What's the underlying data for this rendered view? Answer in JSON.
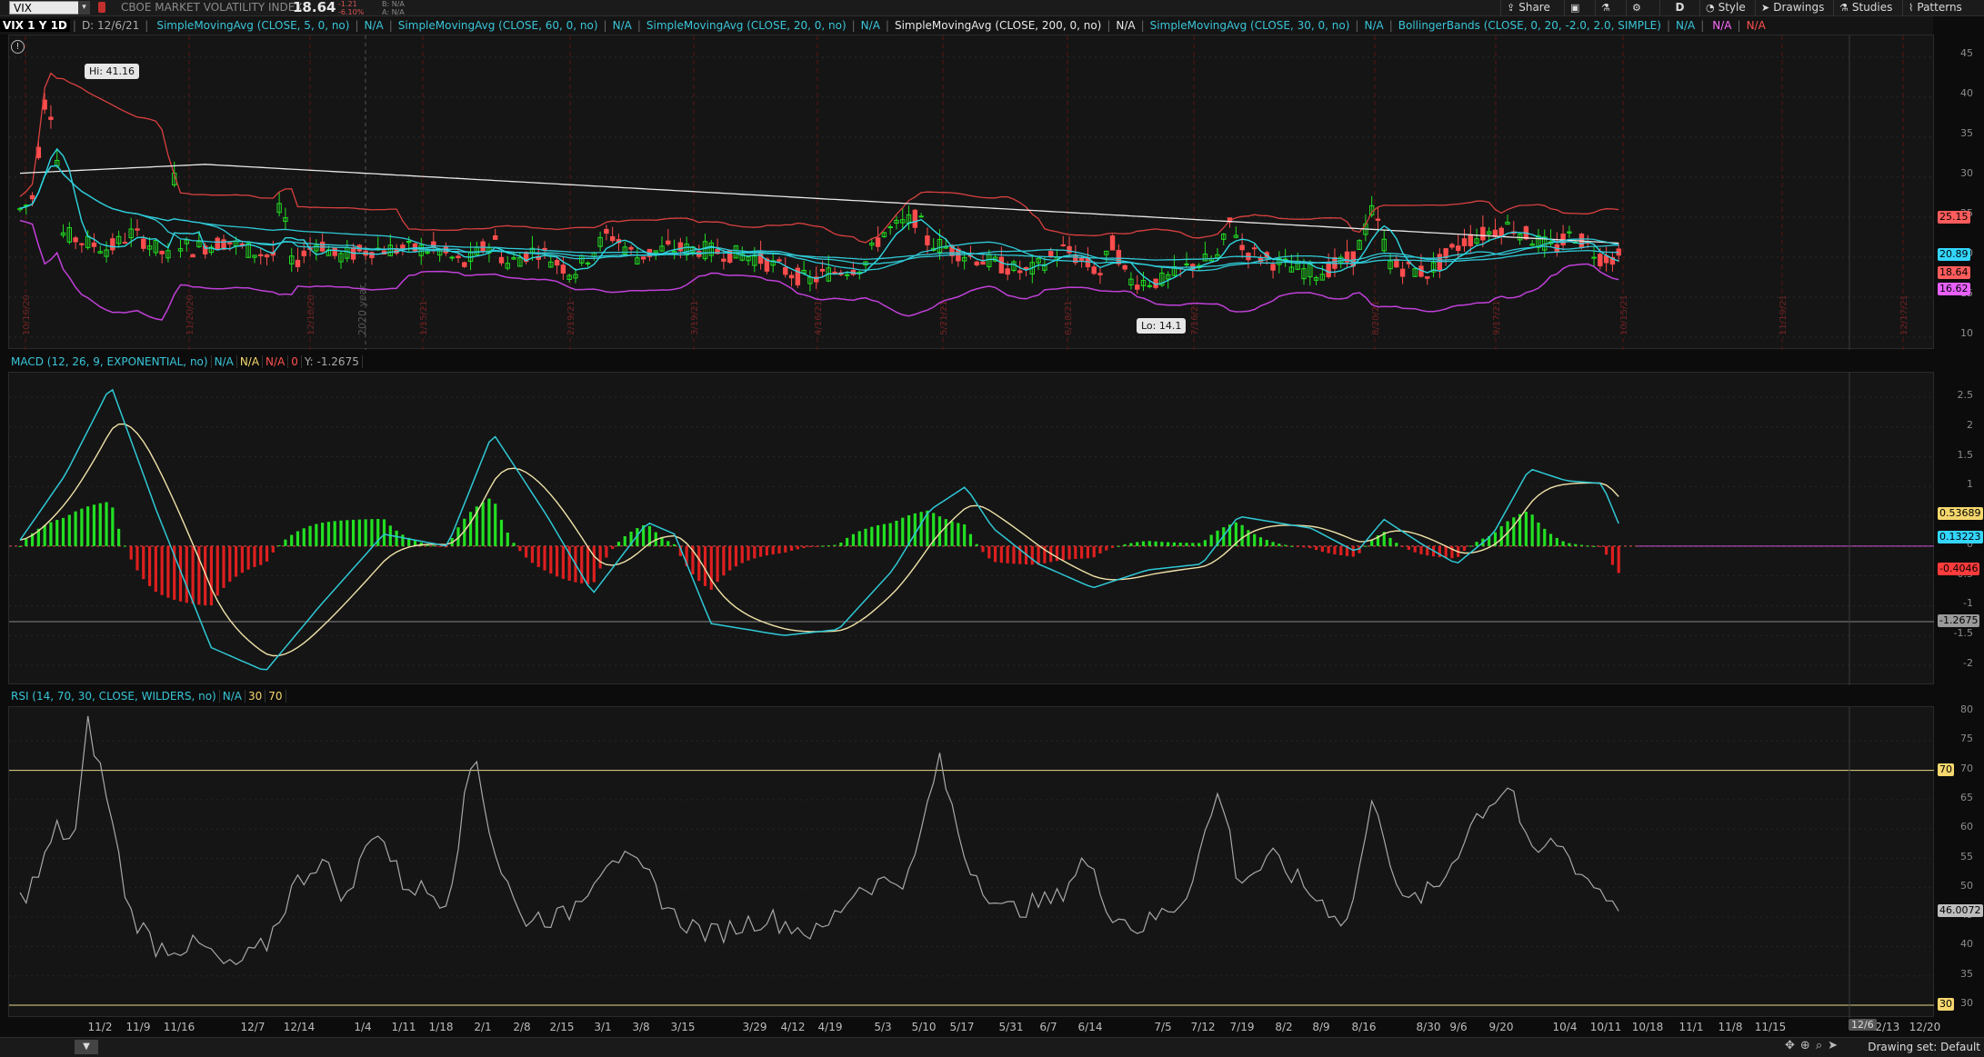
{
  "toolbar": {
    "symbol": "VIX",
    "description": "CBOE MARKET VOLATILITY INDEX",
    "last": "18.64",
    "net_change": "-1.21",
    "pct_change": "-6.10%",
    "bid": "B: N/A",
    "ask": "A: N/A",
    "share": "Share",
    "aggregation": "D",
    "style": "Style",
    "drawings": "Drawings",
    "studies": "Studies",
    "patterns": "Patterns"
  },
  "studybar": {
    "period": "VIX 1 Y 1D",
    "date": "D: 12/6/21",
    "items": [
      {
        "label": "SimpleMovingAvg (CLOSE, 5, 0, no)",
        "value": "N/A",
        "color": "#39c5d8"
      },
      {
        "label": "SimpleMovingAvg (CLOSE, 60, 0, no)",
        "value": "N/A",
        "color": "#39c5d8"
      },
      {
        "label": "SimpleMovingAvg (CLOSE, 20, 0, no)",
        "value": "N/A",
        "color": "#39c5d8"
      },
      {
        "label": "SimpleMovingAvg (CLOSE, 200, 0, no)",
        "value": "N/A",
        "color": "#e8e8e8"
      },
      {
        "label": "SimpleMovingAvg (CLOSE, 30, 0, no)",
        "value": "N/A",
        "color": "#39c5d8"
      },
      {
        "label": "BollingerBands (CLOSE, 0, 20, -2.0, 2.0, SIMPLE)",
        "value": "N/A",
        "color": "#39c5d8"
      }
    ],
    "extra1": "N/A",
    "extra2": "N/A"
  },
  "price_pane": {
    "hi_bubble": "Hi: 41.16",
    "lo_bubble": "Lo: 14.1",
    "watermark": "2020 year",
    "yticks": [
      "45",
      "40",
      "35",
      "30",
      "25",
      "20",
      "15",
      "10"
    ],
    "labels": [
      {
        "text": "25.15",
        "color": "#ff5c5c"
      },
      {
        "text": "20.89",
        "color": "#33d6ff"
      },
      {
        "text": "18.64",
        "color": "#ff5c5c"
      },
      {
        "text": "16.62",
        "color": "#e860ff"
      }
    ],
    "vdates": [
      "10/16/20",
      "11/20/20",
      "12/18/20",
      "1/15/21",
      "2/19/21",
      "3/19/21",
      "4/16/21",
      "5/21/21",
      "6/18/21",
      "7/16/21",
      "8/20/21",
      "9/17/21",
      "10/15/21",
      "11/19/21",
      "12/17/21"
    ]
  },
  "macd_pane": {
    "title": "MACD (12, 26, 9, EXPONENTIAL, no)",
    "v1": "N/A",
    "v2": "N/A",
    "v3": "N/A",
    "v4": "0",
    "y": "Y: -1.2675",
    "yticks": [
      "2.5",
      "2",
      "1.5",
      "1",
      "0.5",
      "0",
      "-0.5",
      "-1",
      "-1.5",
      "-2"
    ],
    "labels": [
      {
        "text": "0.53689",
        "color": "#f5d76e"
      },
      {
        "text": "0.13223",
        "color": "#33d6ff"
      },
      {
        "text": "-0.4046",
        "color": "#ff3b3b"
      },
      {
        "text": "-1.2675",
        "color": "#9a9a9a"
      }
    ]
  },
  "rsi_pane": {
    "title": "RSI (14, 70, 30, CLOSE, WILDERS, no)",
    "value": "N/A",
    "os": "30",
    "ob": "70",
    "yticks": [
      "80",
      "75",
      "70",
      "65",
      "60",
      "55",
      "50",
      "45",
      "40",
      "35",
      "30"
    ],
    "labels": [
      {
        "text": "70",
        "color": "#f5d76e"
      },
      {
        "text": "46.0072",
        "color": "#bdbdbd"
      },
      {
        "text": "30",
        "color": "#f5d76e"
      }
    ]
  },
  "xaxis": [
    "11/2",
    "11/9",
    "11/16",
    "12/7",
    "12/14",
    "1/4",
    "1/11",
    "1/18",
    "2/1",
    "2/8",
    "2/15",
    "3/1",
    "3/8",
    "3/15",
    "3/29",
    "4/12",
    "4/19",
    "5/3",
    "5/10",
    "5/17",
    "5/31",
    "6/7",
    "6/14",
    "7/5",
    "7/12",
    "7/19",
    "8/2",
    "8/9",
    "8/16",
    "8/30",
    "9/6",
    "9/20",
    "10/4",
    "10/11",
    "10/18",
    "11/1",
    "11/8",
    "11/15",
    "12/13",
    "12/20"
  ],
  "date_flag": "12/6",
  "bottom": {
    "drawing_set": "Drawing set: Default"
  }
}
